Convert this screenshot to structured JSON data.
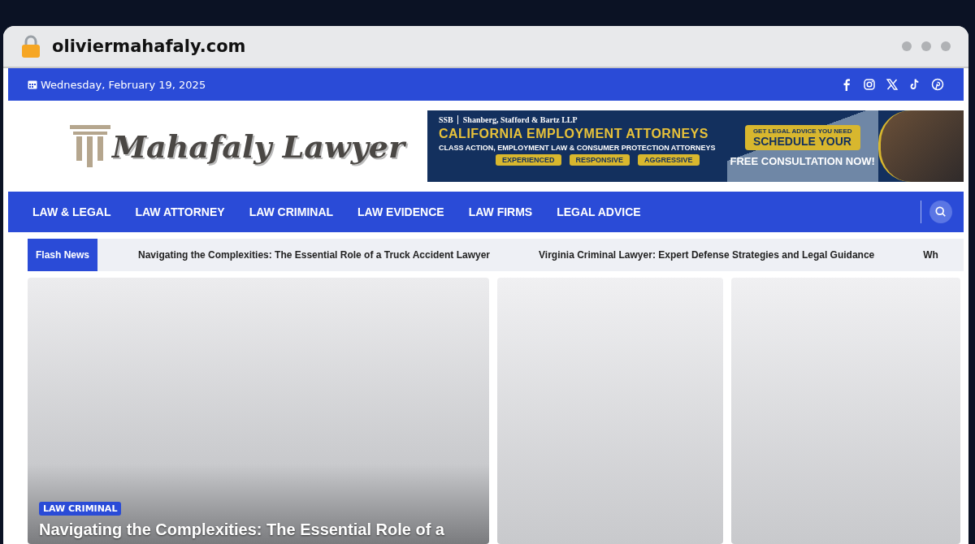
{
  "browser": {
    "url": "oliviermahafaly.com"
  },
  "top_bar": {
    "date": "Wednesday, February 19, 2025",
    "social": [
      {
        "kind": "facebook"
      },
      {
        "kind": "instagram"
      },
      {
        "kind": "x"
      },
      {
        "kind": "tiktok"
      },
      {
        "kind": "pinterest"
      }
    ]
  },
  "header": {
    "logo_text": "Mahafaly Lawyer",
    "ad": {
      "firm": "Shanberg, Stafford & Bartz LLP",
      "firm_short": "SSB",
      "headline": "CALIFORNIA EMPLOYMENT ATTORNEYS",
      "subline": "CLASS ACTION, EMPLOYMENT LAW & CONSUMER PROTECTION ATTORNEYS",
      "tags": [
        "EXPERIENCED",
        "RESPONSIVE",
        "AGGRESSIVE"
      ],
      "cta_small": "GET LEGAL ADVICE YOU NEED",
      "cta": "SCHEDULE YOUR",
      "offer": "FREE CONSULTATION NOW!"
    }
  },
  "nav": {
    "items": [
      {
        "label": "LAW & LEGAL"
      },
      {
        "label": "LAW ATTORNEY"
      },
      {
        "label": "LAW CRIMINAL"
      },
      {
        "label": "LAW EVIDENCE"
      },
      {
        "label": "LAW FIRMS"
      },
      {
        "label": "LEGAL ADVICE"
      }
    ]
  },
  "flash_news": {
    "label": "Flash News",
    "items": [
      "Navigating the Complexities: The Essential Role of a Truck Accident Lawyer",
      "Virginia Criminal Lawyer: Expert Defense Strategies and Legal Guidance",
      "Wh"
    ]
  },
  "featured": {
    "category": "LAW CRIMINAL",
    "title": "Navigating the Complexities: The Essential Role of a"
  }
}
